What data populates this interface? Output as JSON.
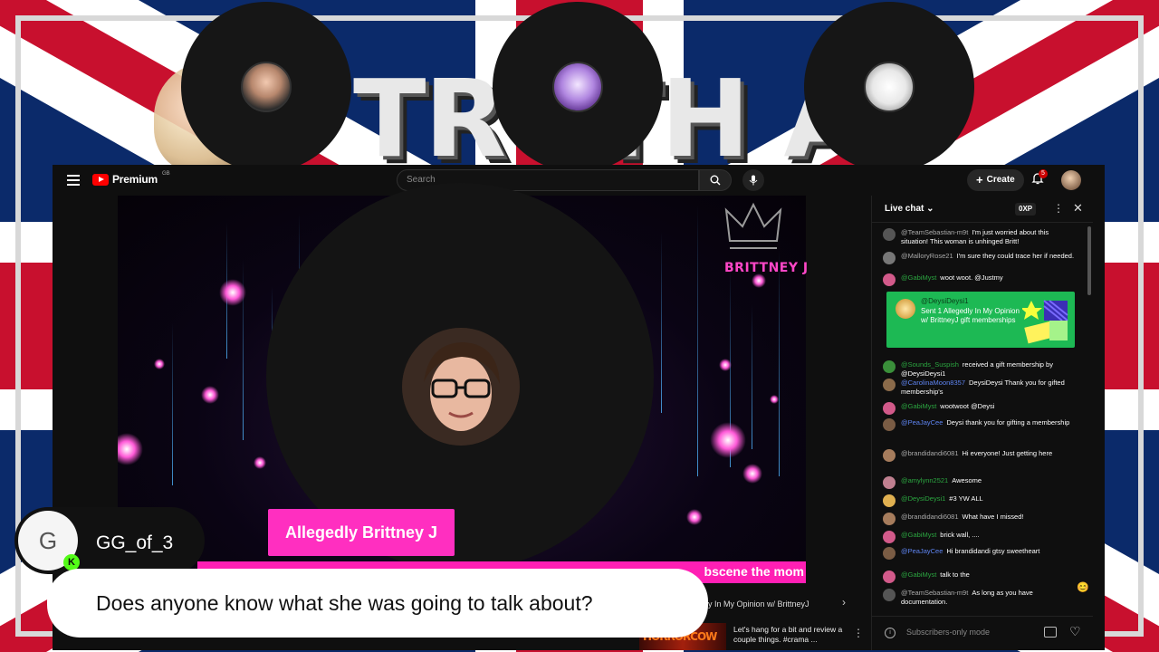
{
  "overlay": {
    "title_art": "TRUTH A",
    "guests": [
      {
        "name": "guest-1"
      },
      {
        "name": "guest-2"
      },
      {
        "name": "guest-3"
      }
    ],
    "comment": {
      "avatar_letter": "G",
      "platform_badge": "K",
      "username": "GG_of_3",
      "text": "Does anyone know what she was going to talk about?"
    }
  },
  "youtube": {
    "brand": "Premium",
    "region": "GB",
    "search_placeholder": "Search",
    "create_label": "Create",
    "notification_count": "5",
    "stream": {
      "brand_text": "BRITTNEY J",
      "name_plate": "Allegedly Brittney J",
      "ticker_text": "bscene the mom",
      "next_title": "edly In My Opinion w/ BrittneyJ",
      "next_thumb_text": "HORRORCOW",
      "next_description": "Let's hang for a bit and review a couple things. #crama ..."
    }
  },
  "chat": {
    "title": "Live chat",
    "xp": "0XP",
    "input_placeholder": "Subscribers-only mode",
    "gift": {
      "author": "@DeysiDeysi1",
      "text": "Sent 1 Allegedly In My Opinion w/ BrittneyJ gift memberships"
    },
    "messages": [
      {
        "author": "@TeamSebastian-m9t",
        "text": "I'm just worried about this situation! This woman is unhinged Britt!",
        "cls": ""
      },
      {
        "author": "@MalloryRose21",
        "text": "I'm sure they could trace her if needed.",
        "cls": ""
      },
      {
        "author": "@GabiMyst",
        "text": "woot woot. @Justmy",
        "cls": "member"
      },
      {
        "author": "@Sounds_Suspish",
        "text": "received a gift membership by @DeysiDeysi1",
        "cls": "member"
      },
      {
        "author": "@CarolinaMoon8357",
        "text": "DeysiDeysi Thank you for gifted membership's",
        "cls": "mod"
      },
      {
        "author": "@GabiMyst",
        "text": "wootwoot @Deysi",
        "cls": "member"
      },
      {
        "author": "@PeaJayCee",
        "text": "Deysi thank you for gifting a membership",
        "cls": "mod"
      },
      {
        "author": "@brandidandi6081",
        "text": "Hi everyone! Just getting here",
        "cls": ""
      },
      {
        "author": "@amylynn2521",
        "text": "Awesome",
        "cls": "member"
      },
      {
        "author": "@DeysiDeysi1",
        "text": "#3  YW ALL",
        "cls": "member"
      },
      {
        "author": "@brandidandi6081",
        "text": "What have I missed!",
        "cls": ""
      },
      {
        "author": "@GabiMyst",
        "text": "brick wall, ....",
        "cls": "member"
      },
      {
        "author": "@PeaJayCee",
        "text": "Hi brandidandi gtsy sweetheart",
        "cls": "mod"
      },
      {
        "author": "@GabiMyst",
        "text": "talk to the",
        "cls": "member"
      },
      {
        "author": "@TeamSebastian-m9t",
        "text": "As long as you have documentation.",
        "cls": ""
      }
    ]
  },
  "colors": {
    "flag_blue": "#0b2a6a",
    "flag_red": "#c8102e",
    "accent_pink": "#ff2fc0",
    "gift_green": "#1db954",
    "kick_green": "#53fc18"
  }
}
